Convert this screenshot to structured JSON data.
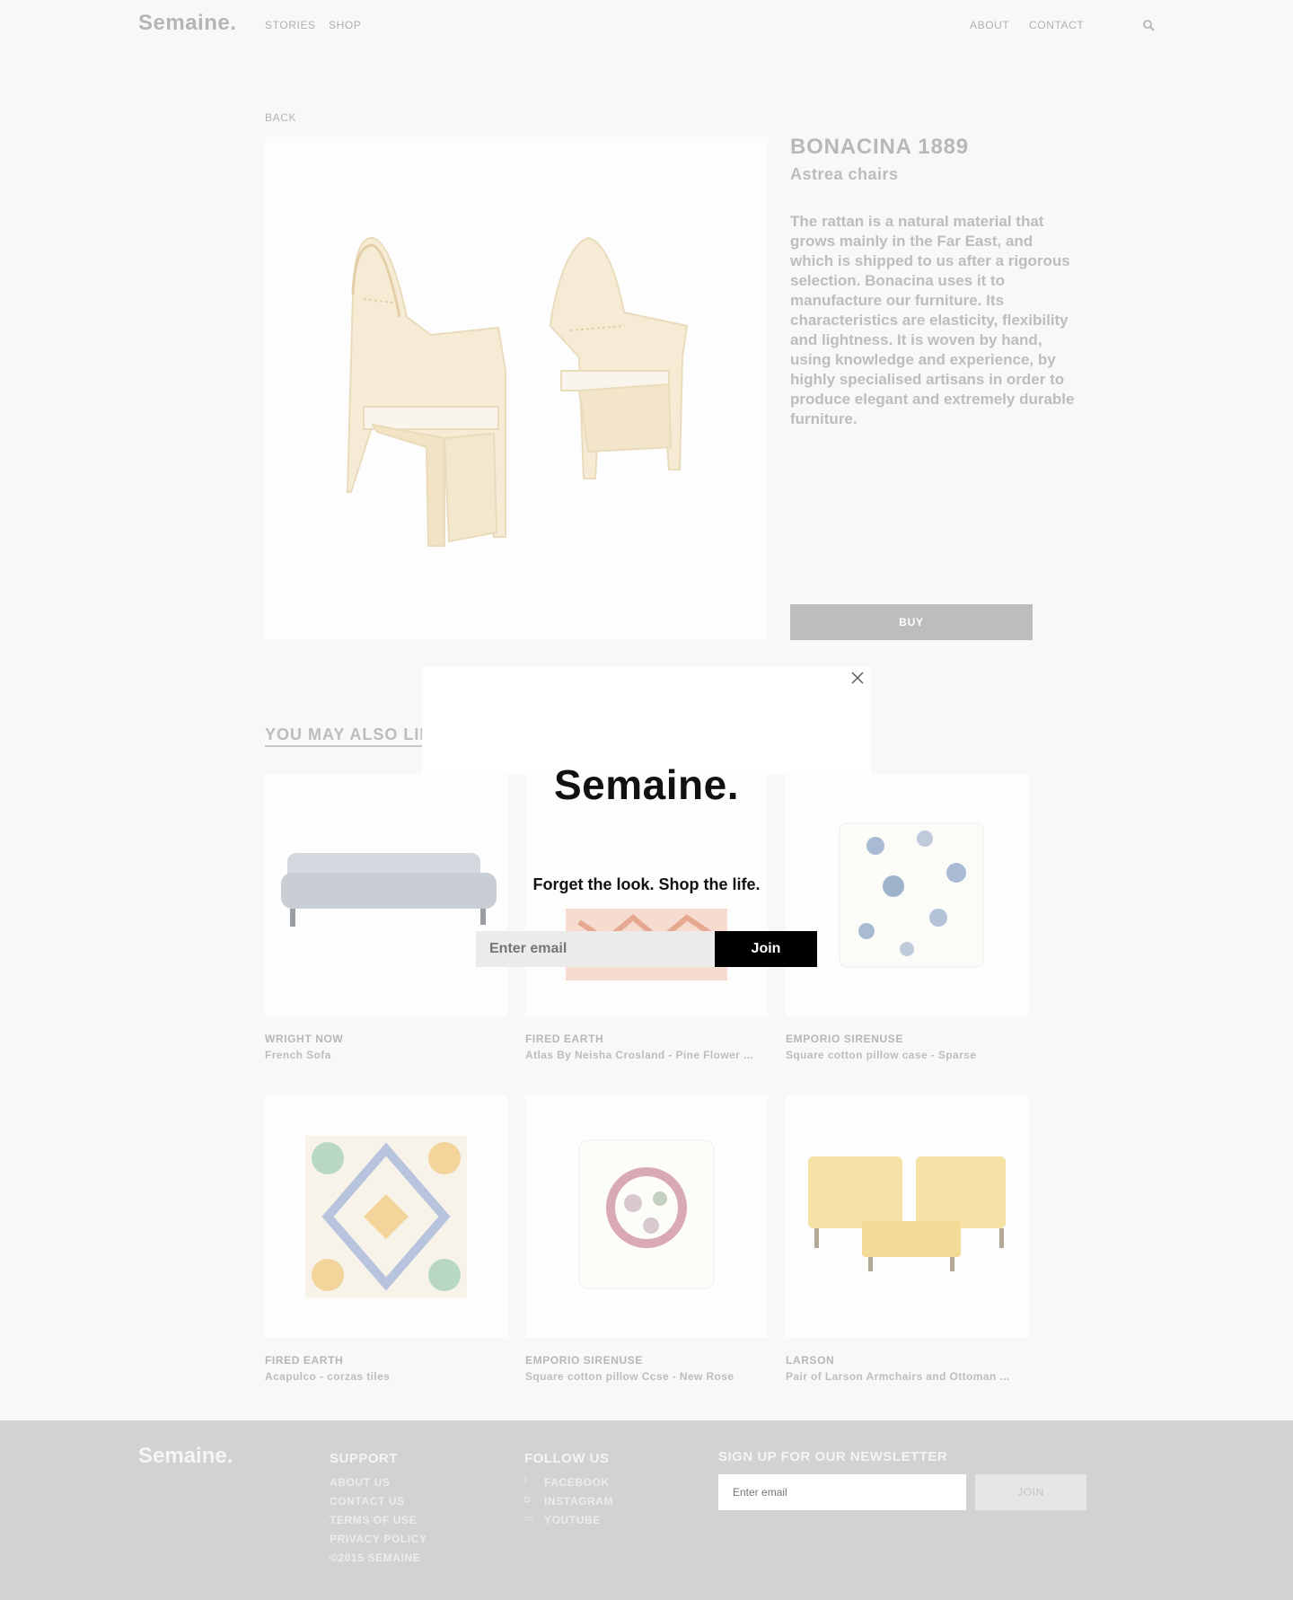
{
  "header": {
    "logo": "Semaine.",
    "nav_left": [
      "STORIES",
      "SHOP"
    ],
    "nav_right": [
      "ABOUT",
      "CONTACT"
    ]
  },
  "back_label": "BACK",
  "product": {
    "brand": "BONACINA 1889",
    "name": "Astrea chairs",
    "description": "The rattan is a natural material that grows mainly in the Far East, and which is shipped to us after a rigorous selection. Bonacina uses it to manufacture our furniture. Its characteristics are elasticity, flexibility and lightness. It is woven by hand, using knowledge and experience, by highly specialised artisans in order to produce elegant and extremely durable furniture.",
    "buy_label": "BUY"
  },
  "also_like": {
    "heading": "YOU MAY ALSO LIKE",
    "items": [
      {
        "brand": "WRIGHT NOW",
        "title": "French Sofa"
      },
      {
        "brand": "FIRED EARTH",
        "title": "Atlas By Neisha Crosland - Pine Flower ..."
      },
      {
        "brand": "EMPORIO SIRENUSE",
        "title": "Square cotton pillow case - Sparse"
      },
      {
        "brand": "FIRED EARTH",
        "title": "Acapulco - corzas tiles"
      },
      {
        "brand": "EMPORIO SIRENUSE",
        "title": "Square cotton pillow Ccse - New Rose"
      },
      {
        "brand": "LARSON",
        "title": "Pair of Larson Armchairs and Ottoman ..."
      }
    ]
  },
  "modal": {
    "logo": "Semaine.",
    "tagline": "Forget the look. Shop the life.",
    "email_placeholder": "Enter email",
    "join_label": "Join"
  },
  "footer": {
    "logo": "Semaine.",
    "support": {
      "heading": "SUPPORT",
      "links": [
        "ABOUT US",
        "CONTACT US",
        "TERMS OF USE",
        "PRIVACY POLICY",
        "©2015 SEMAINE"
      ]
    },
    "follow": {
      "heading": "FOLLOW US",
      "links": [
        "FACEBOOK",
        "INSTAGRAM",
        "YOUTUBE"
      ],
      "icons": [
        "facebook-icon",
        "instagram-icon",
        "youtube-icon"
      ]
    },
    "newsletter": {
      "heading": "SIGN UP FOR OUR NEWSLETTER",
      "email_placeholder": "Enter email",
      "join_label": "JOIN"
    }
  },
  "colors": {
    "background": "#f8f8f8",
    "footer_bg": "#d2d2d2",
    "modal_button": "#000000",
    "buy_button": "#bdbdbd"
  }
}
